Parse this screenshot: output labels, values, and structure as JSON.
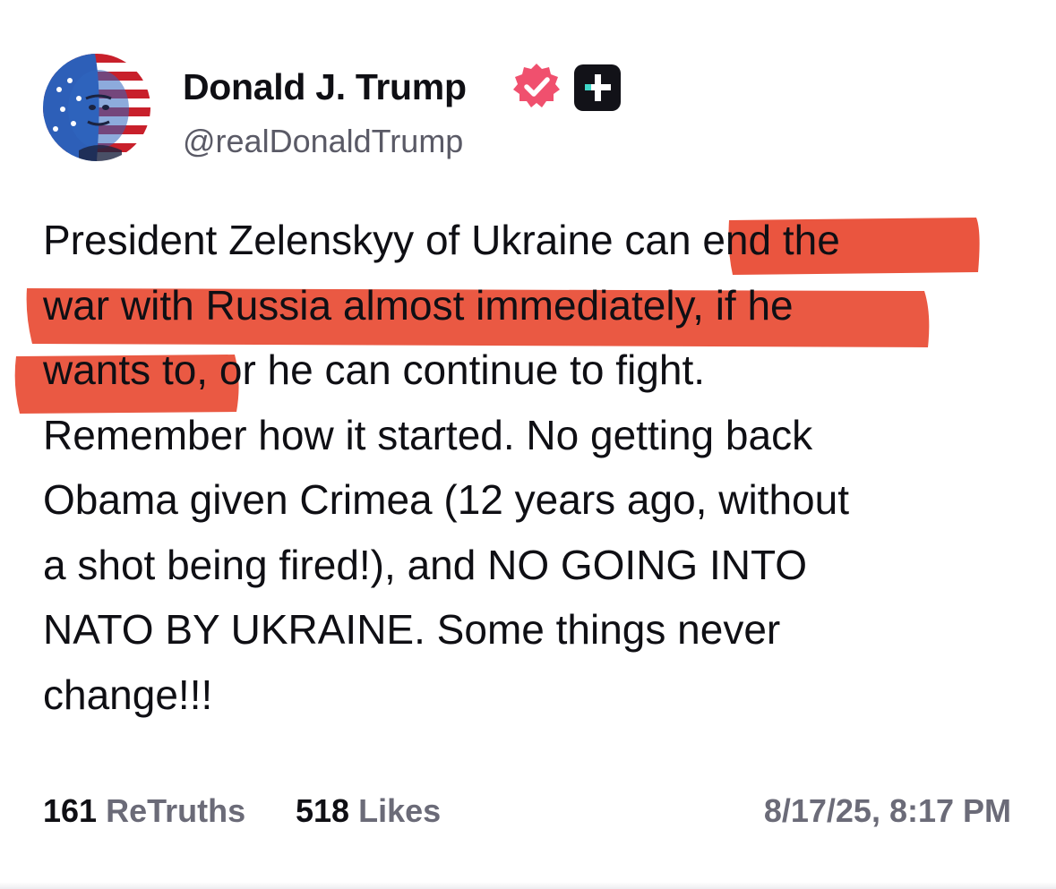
{
  "author": {
    "display_name": "Donald J. Trump",
    "handle": "@realDonaldTrump",
    "avatar_icon": "flag-portrait-avatar",
    "verified_icon": "verified-badge-icon",
    "verified_color": "#f0506e",
    "plus_badge_icon": "plus-badge-icon"
  },
  "post": {
    "lines": [
      "President Zelenskyy of Ukraine can end the",
      "war with Russia almost immediately, if he",
      "wants to, or he can continue to fight.",
      "Remember how it started. No getting back",
      "Obama given Crimea (12 years ago, without",
      "a shot being fired!), and NO GOING INTO",
      "NATO BY UKRAINE. Some things never",
      "change!!!"
    ],
    "highlight_color": "#e8472f"
  },
  "stats": {
    "retruths_count": "161",
    "retruths_label": "ReTruths",
    "likes_count": "518",
    "likes_label": "Likes"
  },
  "timestamp": "8/17/25, 8:17 PM"
}
